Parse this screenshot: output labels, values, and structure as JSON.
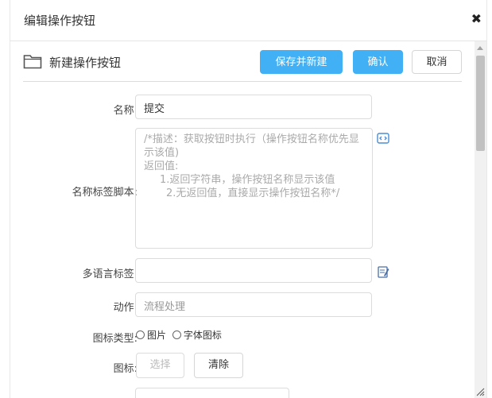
{
  "dialog": {
    "title": "编辑操作按钮",
    "close_symbol": "✖"
  },
  "header": {
    "icon": "folder-icon",
    "title": "新建操作按钮",
    "save_new_label": "保存并新建",
    "confirm_label": "确认",
    "cancel_label": "取消"
  },
  "form": {
    "name_label": "名称:",
    "name_value": "提交",
    "label_script_label": "名称标签脚本:",
    "label_script_lines": [
      "/*描述：获取按钮时执行（操作按钮名称优先显示该值)",
      "返回值:",
      "1.返回字符串，操作按钮名称显示该值",
      "2.无返回值，直接显示操作按钮名称*/"
    ],
    "multilang_label": "多语言标签:",
    "multilang_value": "",
    "action_label": "动作:",
    "action_placeholder": "流程处理",
    "icon_type_label": "图标类型:",
    "icon_type_options": [
      "图片",
      "字体图标"
    ],
    "icon_label": "图标:",
    "select_button": "选择",
    "clear_button": "清除"
  },
  "colors": {
    "primary": "#41b0f5",
    "border": "#dcdcdc"
  }
}
